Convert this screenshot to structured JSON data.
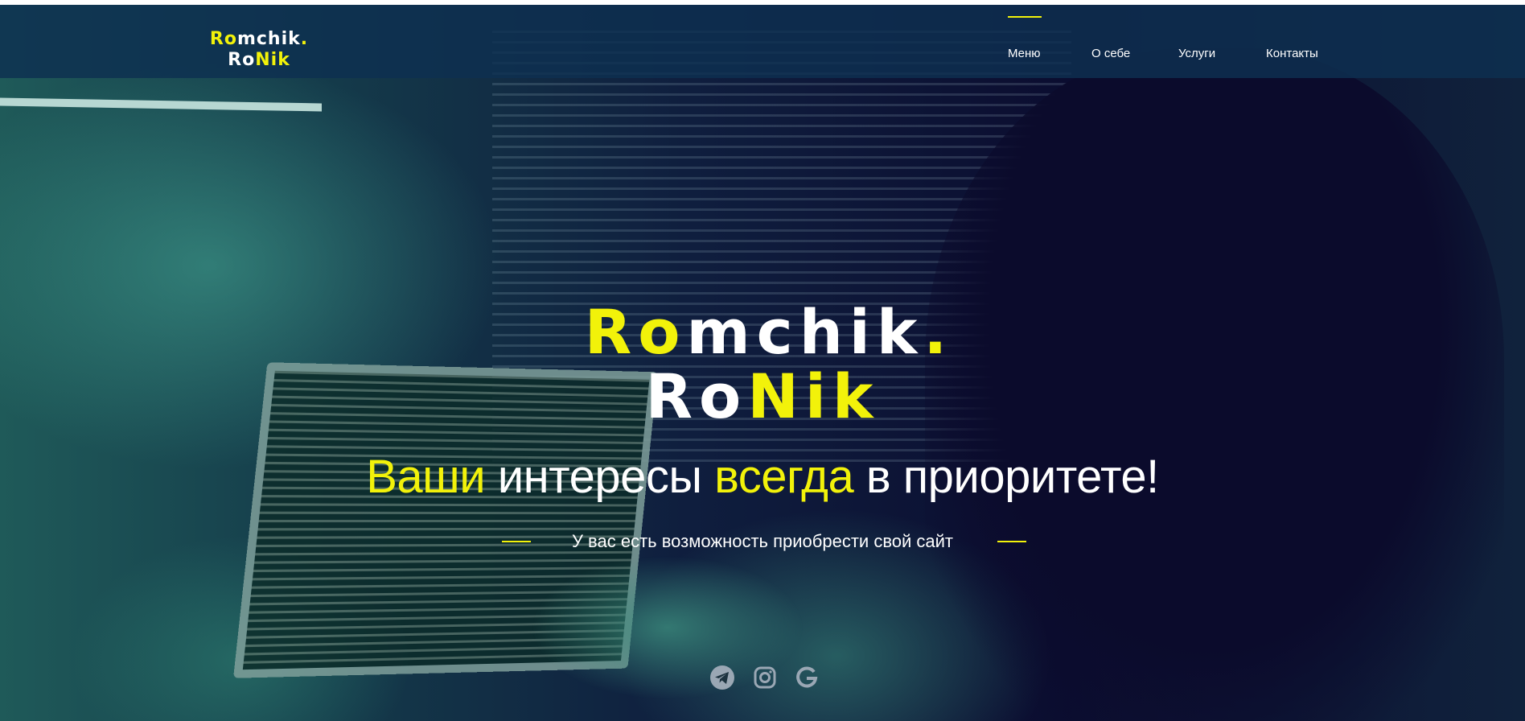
{
  "brand": {
    "line1_a": "Ro",
    "line1_b": "mchik",
    "line1_c": ".",
    "line2_a": "Ro",
    "line2_b": "Nik",
    "accent_color": "#f2f20a"
  },
  "nav": {
    "items": [
      {
        "label": "Меню",
        "active": true
      },
      {
        "label": "О себе",
        "active": false
      },
      {
        "label": "Услуги",
        "active": false
      },
      {
        "label": "Контакты",
        "active": false
      }
    ]
  },
  "hero": {
    "title_line1_a": "Ro",
    "title_line1_b": "mchik",
    "title_line1_c": ".",
    "title_line2_a": "Ro",
    "title_line2_b": "Nik",
    "tagline_1": "Ваши",
    "tagline_2": " интересы ",
    "tagline_3": "всегда",
    "tagline_4": " в приоритете!",
    "subtitle": "У вас есть возможность приобрести свой сайт"
  },
  "social": [
    {
      "icon": "telegram-icon"
    },
    {
      "icon": "instagram-icon"
    },
    {
      "icon": "google-icon"
    }
  ]
}
